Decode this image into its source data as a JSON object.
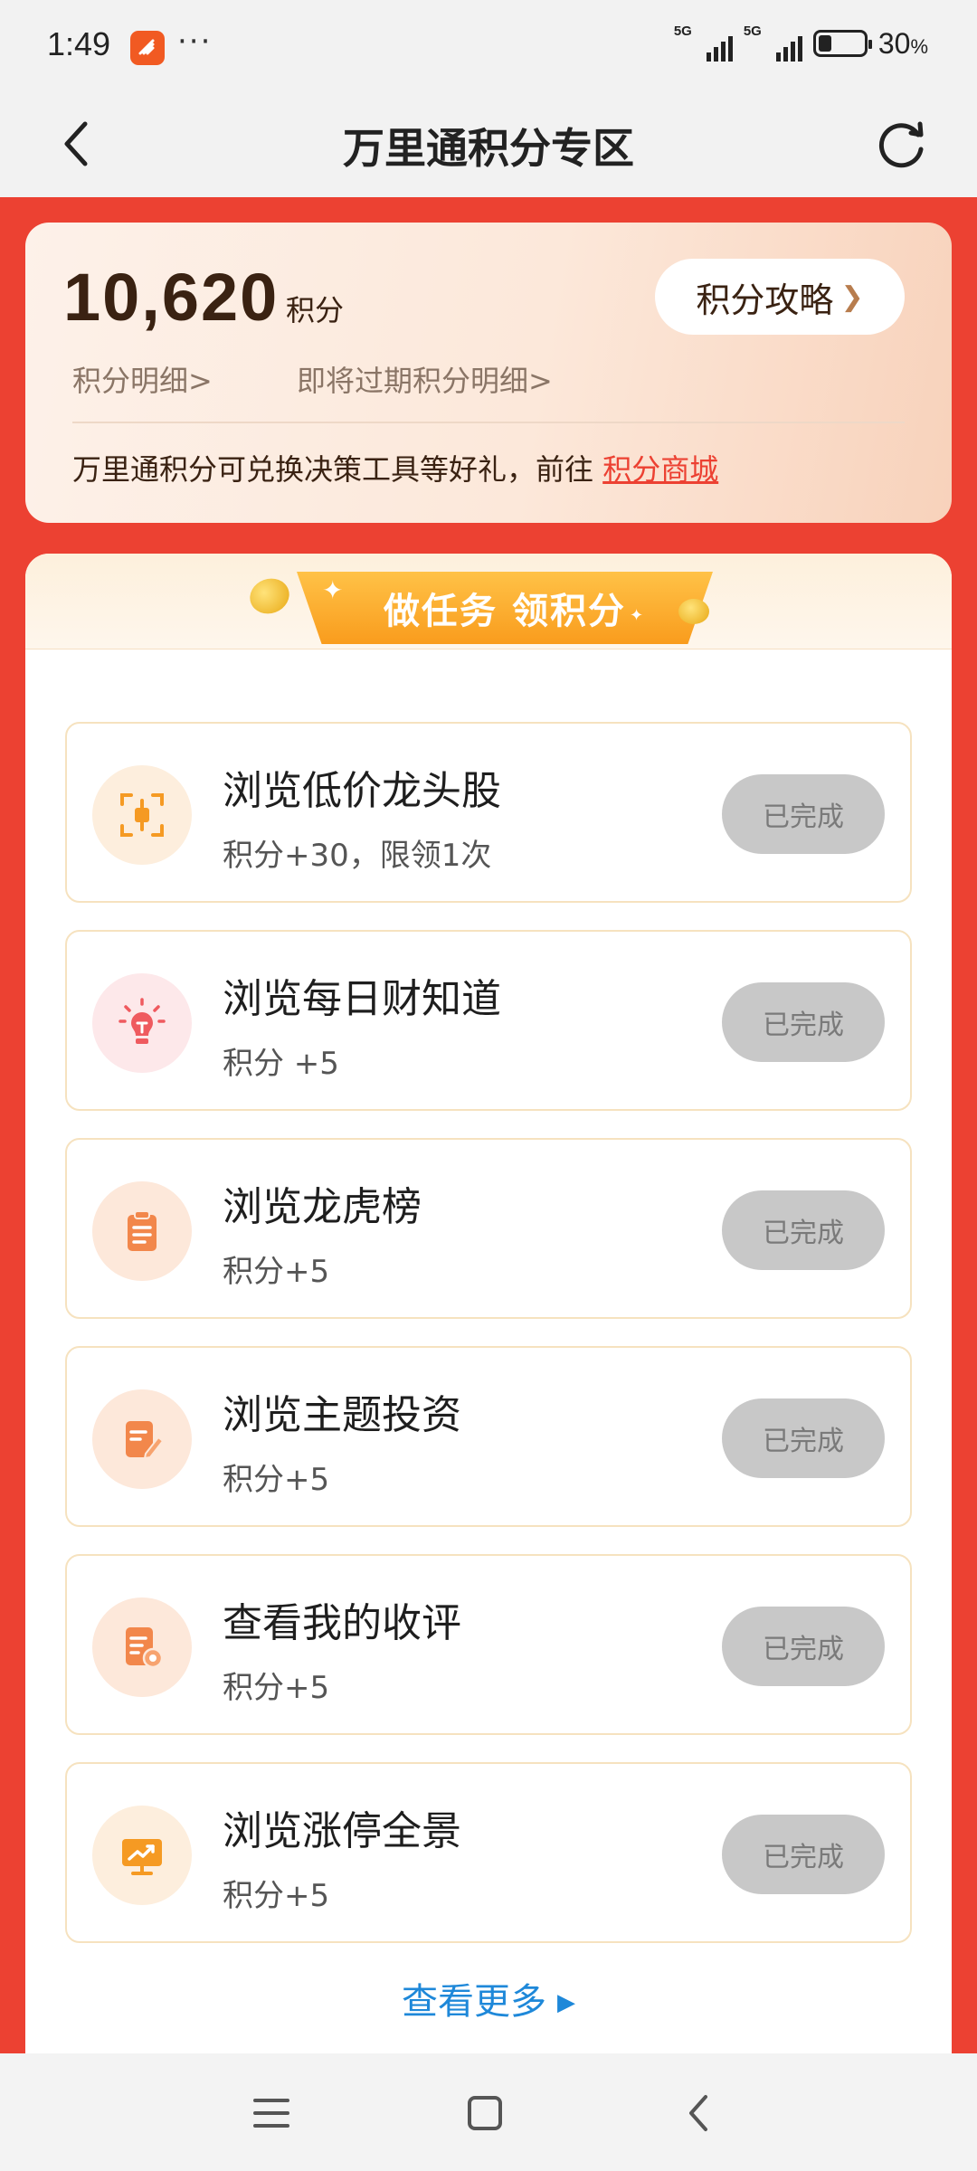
{
  "status_bar": {
    "time": "1:49",
    "more": "···",
    "signal_1": "5G",
    "signal_2": "5G",
    "battery_percent_value": "30",
    "battery_percent_sign": "%",
    "battery_level": 0.3
  },
  "header": {
    "title": "万里通积分专区",
    "back_icon": "chevron-left-icon",
    "refresh_icon": "refresh-icon"
  },
  "points_card": {
    "value": "10,620",
    "unit": "积分",
    "guide_label": "积分攻略",
    "guide_arrow": "❯",
    "detail_link": "积分明细>",
    "expiring_link": "即将过期积分明细>",
    "promo_text": "万里通积分可兑换决策工具等好礼，前往",
    "promo_link": "积分商城"
  },
  "task_panel": {
    "header_label": "做任务 领积分",
    "tasks": [
      {
        "title": "浏览低价龙头股",
        "points": "积分+30，限领1次",
        "button": "已完成",
        "icon": "candlestick-scan-icon",
        "icon_bg": "#fdeedd",
        "icon_color": "#f59a23"
      },
      {
        "title": "浏览每日财知道",
        "points": "积分 +5",
        "button": "已完成",
        "icon": "lightbulb-icon",
        "icon_bg": "#fde8ea",
        "icon_color": "#ef5a5f"
      },
      {
        "title": "浏览龙虎榜",
        "points": "积分+5",
        "button": "已完成",
        "icon": "clipboard-icon",
        "icon_bg": "#fde8da",
        "icon_color": "#f2874b"
      },
      {
        "title": "浏览主题投资",
        "points": "积分+5",
        "button": "已完成",
        "icon": "edit-document-icon",
        "icon_bg": "#fde8da",
        "icon_color": "#f2874b"
      },
      {
        "title": "查看我的收评",
        "points": "积分+5",
        "button": "已完成",
        "icon": "review-document-icon",
        "icon_bg": "#fde8da",
        "icon_color": "#f2874b"
      },
      {
        "title": "浏览涨停全景",
        "points": "积分+5",
        "button": "已完成",
        "icon": "trend-chart-icon",
        "icon_bg": "#fdeedd",
        "icon_color": "#f59a23"
      }
    ],
    "more_link": "查看更多",
    "more_arrow": "▶"
  },
  "colors": {
    "accent_red": "#ec4132",
    "link_blue": "#1e88d9",
    "done_button_bg": "#c8c8c8"
  }
}
